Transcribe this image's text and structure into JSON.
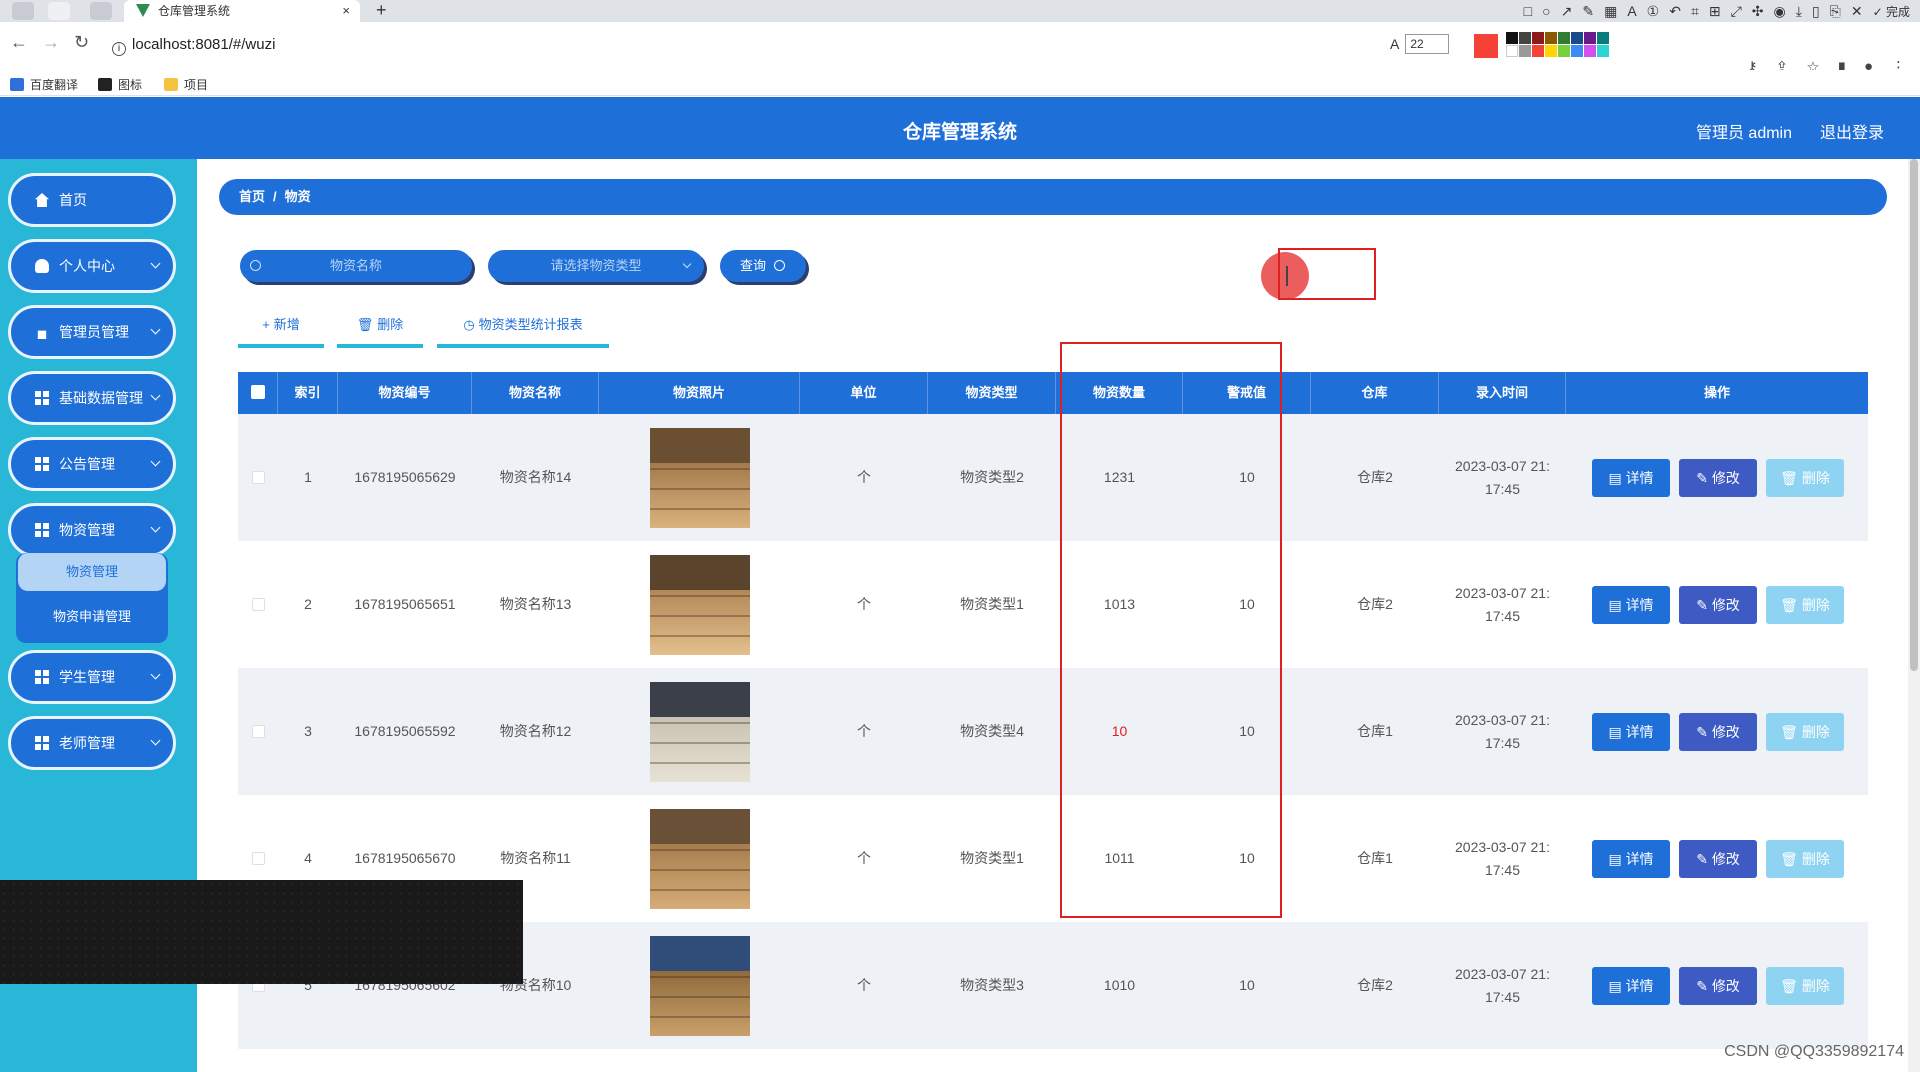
{
  "browser": {
    "tab_title": "仓库管理系统",
    "tab_close": "×",
    "new_tab": "+",
    "url": "localhost:8081/#/wuzi",
    "font_size": "22",
    "done_label": "完成",
    "bookmarks": [
      "百度翻译",
      "图标",
      "项目"
    ]
  },
  "header": {
    "title": "仓库管理系统",
    "user": "管理员 admin",
    "logout": "退出登录"
  },
  "sidebar": {
    "items": [
      {
        "label": "首页",
        "icon": "home-icon"
      },
      {
        "label": "个人中心",
        "icon": "user-icon"
      },
      {
        "label": "管理员管理",
        "icon": "lock-icon"
      },
      {
        "label": "基础数据管理",
        "icon": "grid-icon"
      },
      {
        "label": "公告管理",
        "icon": "grid-icon"
      },
      {
        "label": "物资管理",
        "icon": "grid-icon"
      },
      {
        "label": "学生管理",
        "icon": "grid-icon"
      },
      {
        "label": "老师管理",
        "icon": "grid-icon"
      }
    ],
    "submenu": [
      "物资管理",
      "物资申请管理"
    ]
  },
  "breadcrumb": {
    "home": "首页",
    "sep": "/",
    "current": "物资"
  },
  "search": {
    "name_placeholder": "物资名称",
    "type_placeholder": "请选择物资类型",
    "query_label": "查询"
  },
  "actions": {
    "add": "新增",
    "delete": "删除",
    "report": "物资类型统计报表"
  },
  "table": {
    "headers": [
      "索引",
      "物资编号",
      "物资名称",
      "物资照片",
      "单位",
      "物资类型",
      "物资数量",
      "警戒值",
      "仓库",
      "录入时间",
      "操作"
    ],
    "rows": [
      {
        "index": "1",
        "code": "1678195065629",
        "name": "物资名称14",
        "unit": "个",
        "type": "物资类型2",
        "qty": "1231",
        "warn": "10",
        "warehouse": "仓库2",
        "time1": "2023-03-07 21:",
        "time2": "17:45"
      },
      {
        "index": "2",
        "code": "1678195065651",
        "name": "物资名称13",
        "unit": "个",
        "type": "物资类型1",
        "qty": "1013",
        "warn": "10",
        "warehouse": "仓库2",
        "time1": "2023-03-07 21:",
        "time2": "17:45"
      },
      {
        "index": "3",
        "code": "1678195065592",
        "name": "物资名称12",
        "unit": "个",
        "type": "物资类型4",
        "qty": "10",
        "warn": "10",
        "warehouse": "仓库1",
        "time1": "2023-03-07 21:",
        "time2": "17:45"
      },
      {
        "index": "4",
        "code": "1678195065670",
        "name": "物资名称11",
        "unit": "个",
        "type": "物资类型1",
        "qty": "1011",
        "warn": "10",
        "warehouse": "仓库1",
        "time1": "2023-03-07 21:",
        "time2": "17:45"
      },
      {
        "index": "5",
        "code": "1678195065602",
        "name": "物资名称10",
        "unit": "个",
        "type": "物资类型3",
        "qty": "1010",
        "warn": "10",
        "warehouse": "仓库2",
        "time1": "2023-03-07 21:",
        "time2": "17:45"
      }
    ],
    "op_detail": "详情",
    "op_edit": "修改",
    "op_delete": "删除"
  },
  "watermark": "CSDN @QQ3359892174",
  "colors": {
    "primary": "#1f6fd9",
    "sidebar": "#29b7d8",
    "annotation": "#e02020",
    "warning": "#e02020"
  }
}
